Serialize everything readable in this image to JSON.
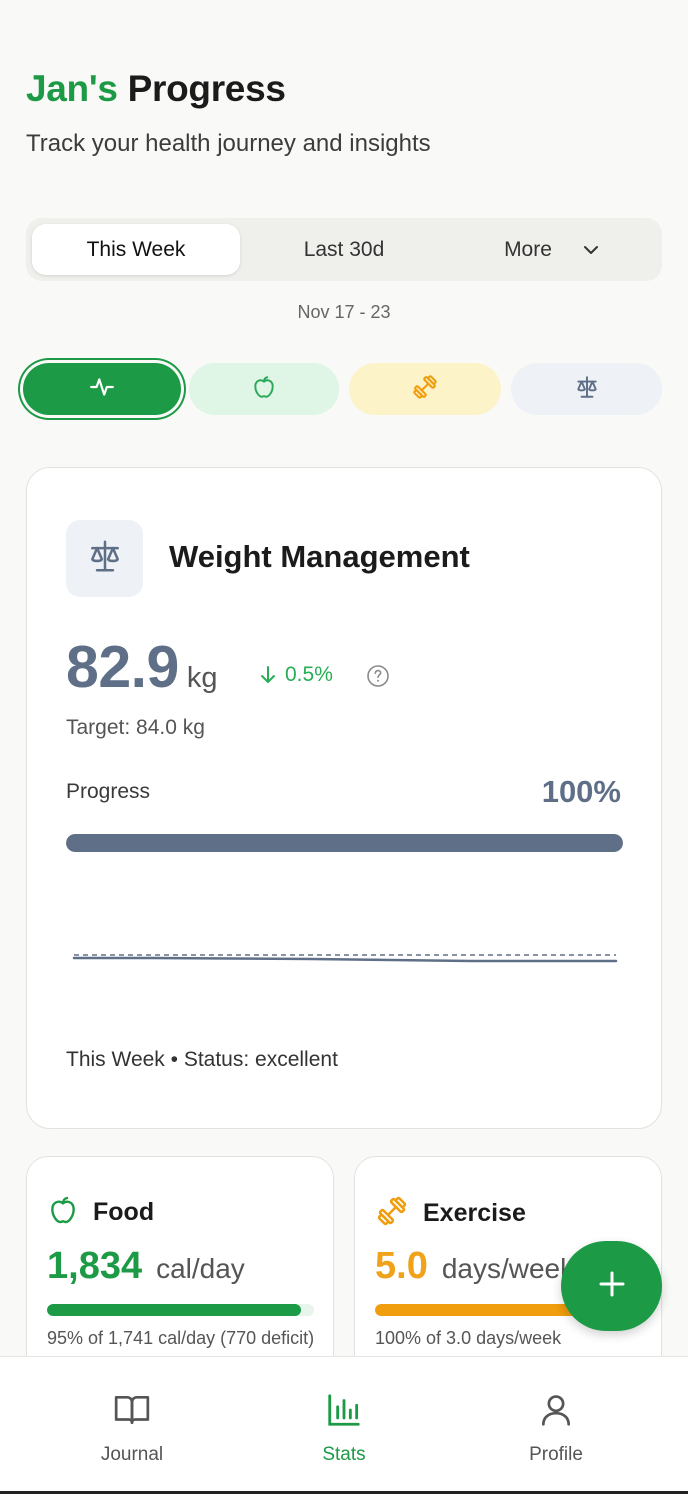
{
  "header": {
    "name": "Jan's",
    "title_rest": "Progress",
    "subtitle": "Track your health journey and insights"
  },
  "range_tabs": [
    {
      "label": "This Week",
      "active": true
    },
    {
      "label": "Last 30d",
      "active": false
    },
    {
      "label": "More",
      "active": false,
      "icon": "chevron-down-icon"
    }
  ],
  "date_range": "Nov 17 - 23",
  "categories": [
    {
      "icon": "activity-icon",
      "active": true
    },
    {
      "icon": "apple-icon",
      "active": false
    },
    {
      "icon": "dumbbell-icon",
      "active": false
    },
    {
      "icon": "scale-icon",
      "active": false
    }
  ],
  "weight_card": {
    "icon": "scale-icon",
    "title": "Weight Management",
    "value": "82.9",
    "unit": "kg",
    "delta": "0.5%",
    "delta_direction": "down",
    "target": "Target: 84.0 kg",
    "progress_label": "Progress",
    "progress_pct_text": "100%",
    "progress_fraction": 1.0,
    "footer": "This Week • Status: excellent"
  },
  "food_card": {
    "icon": "apple-icon",
    "title": "Food",
    "value": "1,834",
    "unit": "cal/day",
    "progress_fraction": 0.95,
    "note": "95% of 1,741 cal/day (770 deficit)"
  },
  "exercise_card": {
    "icon": "dumbbell-icon",
    "title": "Exercise",
    "value": "5.0",
    "unit": "days/week",
    "progress_fraction": 1.0,
    "note": "100% of 3.0 days/week"
  },
  "bottom_nav": [
    {
      "label": "Journal",
      "icon": "book-icon",
      "active": false
    },
    {
      "label": "Stats",
      "icon": "bar-chart-icon",
      "active": true
    },
    {
      "label": "Profile",
      "icon": "user-icon",
      "active": false
    }
  ],
  "colors": {
    "brand_green": "#1c9a46",
    "slate": "#5f6f87",
    "exercise_orange": "#f09d0e"
  }
}
